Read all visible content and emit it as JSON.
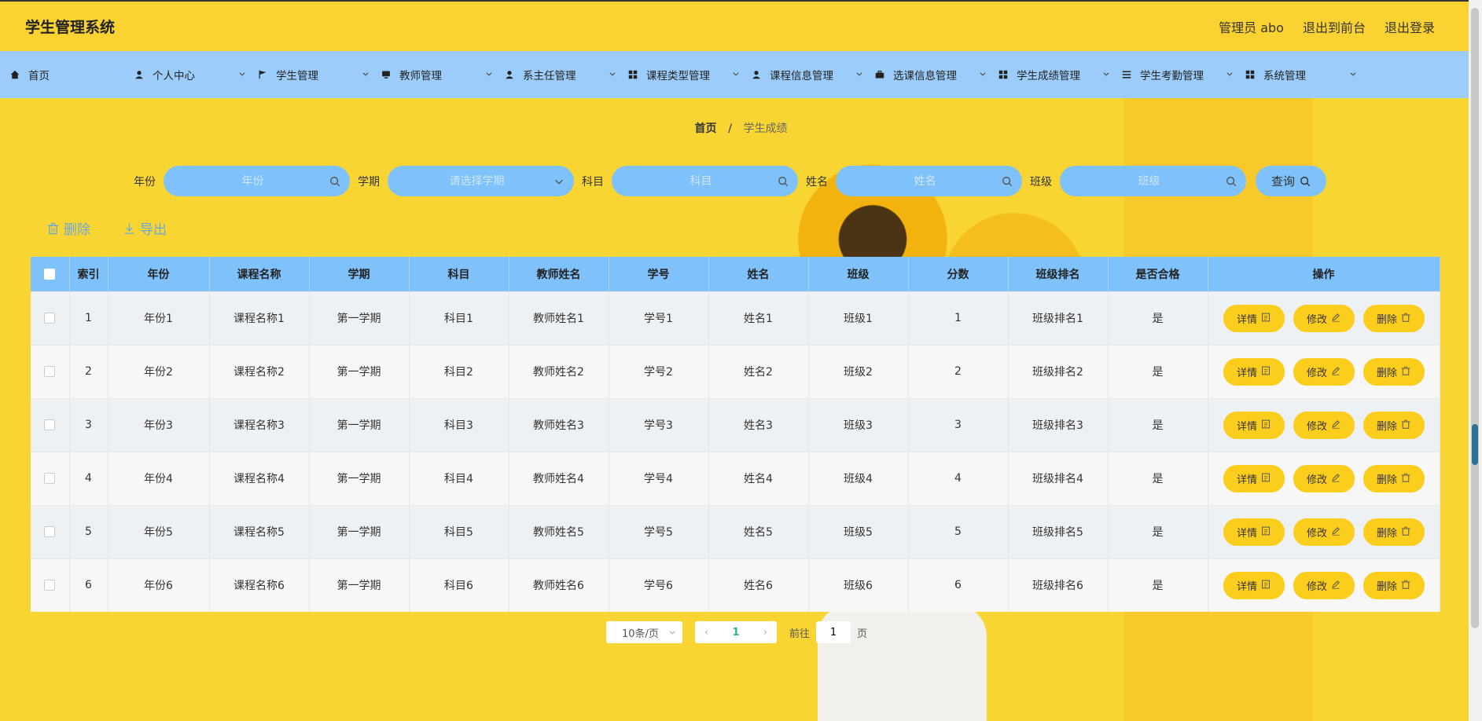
{
  "header": {
    "brand": "学生管理系统",
    "user": "管理员 abo",
    "to_front": "退出到前台",
    "logout": "退出登录"
  },
  "nav": {
    "items": [
      {
        "label": "首页",
        "icon": "home-icon"
      },
      {
        "label": "个人中心",
        "icon": "user-icon"
      },
      {
        "label": "学生管理",
        "icon": "flag-icon"
      },
      {
        "label": "教师管理",
        "icon": "monitor-icon"
      },
      {
        "label": "系主任管理",
        "icon": "user-icon"
      },
      {
        "label": "课程类型管理",
        "icon": "grid-icon"
      },
      {
        "label": "课程信息管理",
        "icon": "user-icon"
      },
      {
        "label": "选课信息管理",
        "icon": "briefcase-icon"
      },
      {
        "label": "学生成绩管理",
        "icon": "grid-icon"
      },
      {
        "label": "学生考勤管理",
        "icon": "list-icon"
      },
      {
        "label": "系统管理",
        "icon": "grid-icon"
      }
    ]
  },
  "breadcrumb": {
    "home": "首页",
    "sep": "/",
    "current": "学生成绩"
  },
  "search": {
    "year_label": "年份",
    "year_placeholder": "年份",
    "term_label": "学期",
    "term_placeholder": "请选择学期",
    "subject_label": "科目",
    "subject_placeholder": "科目",
    "name_label": "姓名",
    "name_placeholder": "姓名",
    "class_label": "班级",
    "class_placeholder": "班级",
    "query_label": "查询"
  },
  "actions": {
    "delete": "删除",
    "export": "导出"
  },
  "table": {
    "headers": [
      "索引",
      "年份",
      "课程名称",
      "学期",
      "科目",
      "教师姓名",
      "学号",
      "姓名",
      "班级",
      "分数",
      "班级排名",
      "是否合格",
      "操作"
    ],
    "rows": [
      [
        "1",
        "年份1",
        "课程名称1",
        "第一学期",
        "科目1",
        "教师姓名1",
        "学号1",
        "姓名1",
        "班级1",
        "1",
        "班级排名1",
        "是"
      ],
      [
        "2",
        "年份2",
        "课程名称2",
        "第一学期",
        "科目2",
        "教师姓名2",
        "学号2",
        "姓名2",
        "班级2",
        "2",
        "班级排名2",
        "是"
      ],
      [
        "3",
        "年份3",
        "课程名称3",
        "第一学期",
        "科目3",
        "教师姓名3",
        "学号3",
        "姓名3",
        "班级3",
        "3",
        "班级排名3",
        "是"
      ],
      [
        "4",
        "年份4",
        "课程名称4",
        "第一学期",
        "科目4",
        "教师姓名4",
        "学号4",
        "姓名4",
        "班级4",
        "4",
        "班级排名4",
        "是"
      ],
      [
        "5",
        "年份5",
        "课程名称5",
        "第一学期",
        "科目5",
        "教师姓名5",
        "学号5",
        "姓名5",
        "班级5",
        "5",
        "班级排名5",
        "是"
      ],
      [
        "6",
        "年份6",
        "课程名称6",
        "第一学期",
        "科目6",
        "教师姓名6",
        "学号6",
        "姓名6",
        "班级6",
        "6",
        "班级排名6",
        "是"
      ]
    ],
    "op_detail": "详情",
    "op_edit": "修改",
    "op_delete": "删除"
  },
  "pager": {
    "page_size": "10条/页",
    "current_page": "1",
    "goto_label": "前往",
    "goto_value": "1",
    "page_unit": "页"
  },
  "colors": {
    "background": "#f9d534",
    "nav": "#9ccdfa",
    "accent_blue": "#7fc1fb",
    "button_yellow": "#fbcd1d",
    "pager_active": "#2bb58a"
  }
}
